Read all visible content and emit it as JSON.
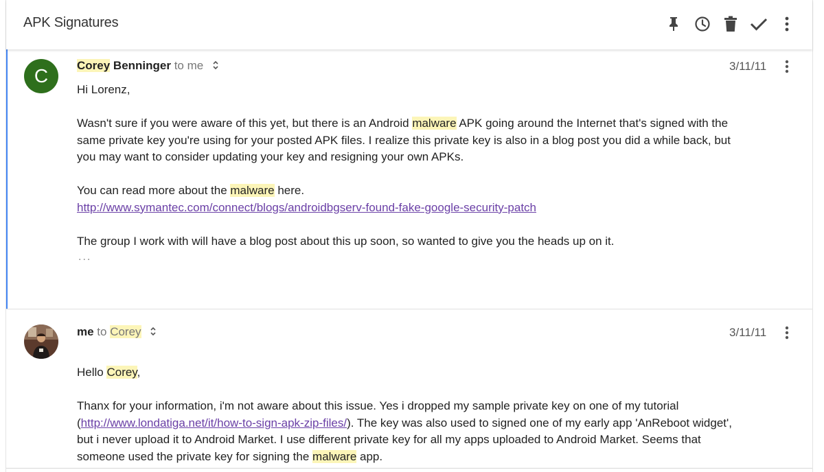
{
  "header": {
    "subject": "APK Signatures",
    "actions": [
      {
        "name": "pin-icon"
      },
      {
        "name": "snooze-clock-icon"
      },
      {
        "name": "trash-icon"
      },
      {
        "name": "done-check-icon"
      },
      {
        "name": "more-vert-icon"
      }
    ]
  },
  "messages": [
    {
      "avatar_letter": "C",
      "avatar_color": "#2e6f1c",
      "sender_first": "Corey",
      "sender_last": " Benninger",
      "recipient_prefix": " to ",
      "recipient": "me",
      "date": "3/11/11",
      "greeting": "Hi Lorenz,",
      "p1a": "Wasn't sure if you were aware of this yet, but there is an Android ",
      "p1_hl": "malware",
      "p1b_line1": " APK going around the Internet that's signed with the",
      "p1_line2": "same private key you're using for your posted APK files. I realize this private key is also in a blog post you did a while back, but",
      "p1_line3": "you may want to consider updating your key and resigning your own APKs.",
      "p2a": "You can read more about the ",
      "p2_hl": "malware",
      "p2b": " here.",
      "link": "http://www.symantec.com/connect/blogs/androidbgserv-found-fake-google-security-patch",
      "p3": "The group I work with will have a blog post about this up soon, so wanted to give you the heads up on it.",
      "trimmed": "..."
    },
    {
      "sender": "me",
      "recipient_prefix": " to ",
      "recipient": "Corey",
      "date": "3/11/11",
      "greeting_a": "Hello ",
      "greeting_hl": "Corey",
      "greeting_b": ",",
      "line1": "Thanx for your information, i'm not aware about this issue. Yes i dropped my sample private key on one of my tutorial",
      "line2_a": "(",
      "line2_link": "http://www.londatiga.net/it/how-to-sign-apk-zip-files/",
      "line2_b": "). The key was also used to signed one of my early app 'AnReboot widget',",
      "line3": "but i never upload it to Android Market. I use different private key for all my apps uploaded to Android Market. Seems that",
      "line4_a": "someone used the private key for signing the ",
      "line4_hl": "malware",
      "line4_b": " app."
    }
  ],
  "colors": {
    "highlight": "#fcf5b8",
    "focus_bar": "#4285f4",
    "link": "#6a3fa6"
  }
}
